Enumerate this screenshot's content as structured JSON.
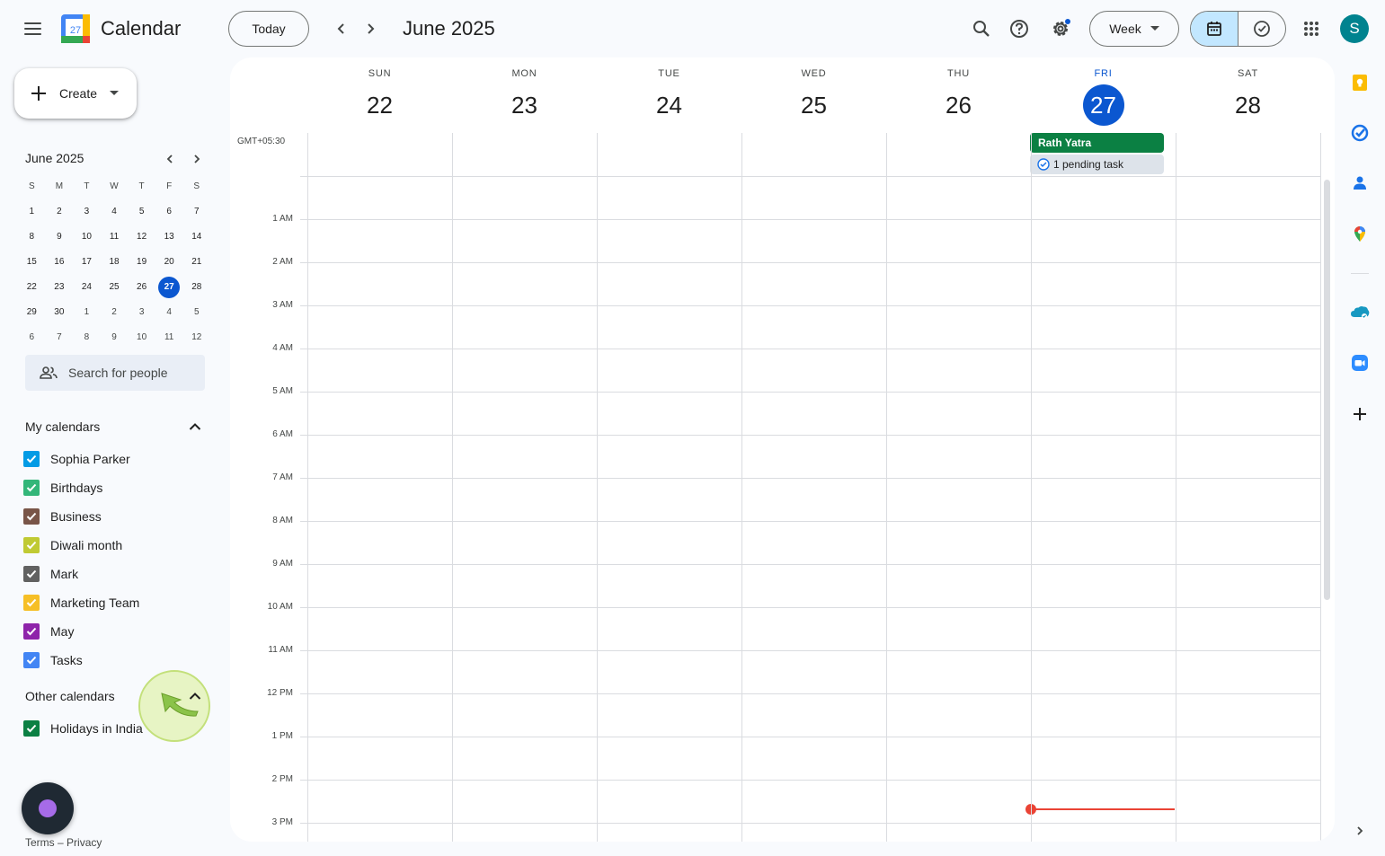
{
  "header": {
    "app_title": "Calendar",
    "logo_day": "27",
    "today_label": "Today",
    "month_label": "June 2025",
    "view_label": "Week",
    "avatar_initial": "S"
  },
  "sidebar": {
    "create_label": "Create",
    "mini_month": "June 2025",
    "weekday_initials": [
      "S",
      "M",
      "T",
      "W",
      "T",
      "F",
      "S"
    ],
    "weeks": [
      [
        "1",
        "2",
        "3",
        "4",
        "5",
        "6",
        "7"
      ],
      [
        "8",
        "9",
        "10",
        "11",
        "12",
        "13",
        "14"
      ],
      [
        "15",
        "16",
        "17",
        "18",
        "19",
        "20",
        "21"
      ],
      [
        "22",
        "23",
        "24",
        "25",
        "26",
        "27",
        "28"
      ],
      [
        "29",
        "30",
        "1",
        "2",
        "3",
        "4",
        "5"
      ],
      [
        "6",
        "7",
        "8",
        "9",
        "10",
        "11",
        "12"
      ]
    ],
    "today_date": "27",
    "search_people_placeholder": "Search for people",
    "my_calendars_title": "My calendars",
    "my_calendars": [
      {
        "label": "Sophia Parker",
        "color": "#039be5"
      },
      {
        "label": "Birthdays",
        "color": "#33b679"
      },
      {
        "label": "Business",
        "color": "#795548"
      },
      {
        "label": "Diwali month",
        "color": "#c0ca33"
      },
      {
        "label": "Mark",
        "color": "#616161"
      },
      {
        "label": "Marketing Team",
        "color": "#f6bf26"
      },
      {
        "label": "May",
        "color": "#8e24aa"
      },
      {
        "label": "Tasks",
        "color": "#4285f4"
      }
    ],
    "other_calendars_title": "Other calendars",
    "other_calendars": [
      {
        "label": "Holidays in India",
        "color": "#0b8043"
      }
    ],
    "footer_terms": "Terms",
    "footer_sep": "–",
    "footer_privacy": "Privacy"
  },
  "week": {
    "timezone": "GMT+05:30",
    "days": [
      {
        "dow": "SUN",
        "date": "22",
        "today": false
      },
      {
        "dow": "MON",
        "date": "23",
        "today": false
      },
      {
        "dow": "TUE",
        "date": "24",
        "today": false
      },
      {
        "dow": "WED",
        "date": "25",
        "today": false
      },
      {
        "dow": "THU",
        "date": "26",
        "today": false
      },
      {
        "dow": "FRI",
        "date": "27",
        "today": true
      },
      {
        "dow": "SAT",
        "date": "28",
        "today": false
      }
    ],
    "hours": [
      "1 AM",
      "2 AM",
      "3 AM",
      "4 AM",
      "5 AM",
      "6 AM",
      "7 AM",
      "8 AM",
      "9 AM",
      "10 AM",
      "11 AM",
      "12 PM",
      "1 PM",
      "2 PM",
      "3 PM"
    ],
    "allday_event": {
      "title": "Rath Yatra",
      "day": "FRI",
      "color": "#0b8043"
    },
    "pending_tasks": "1 pending task"
  },
  "colors": {
    "accent": "#0b57d0",
    "now_indicator": "#ea4335",
    "selected_view_bg": "#c2e7ff"
  },
  "side_panel": [
    "keep-icon",
    "tasks-icon",
    "contacts-icon",
    "maps-icon",
    "salesforce-icon",
    "zoom-icon",
    "add-addon-icon"
  ]
}
